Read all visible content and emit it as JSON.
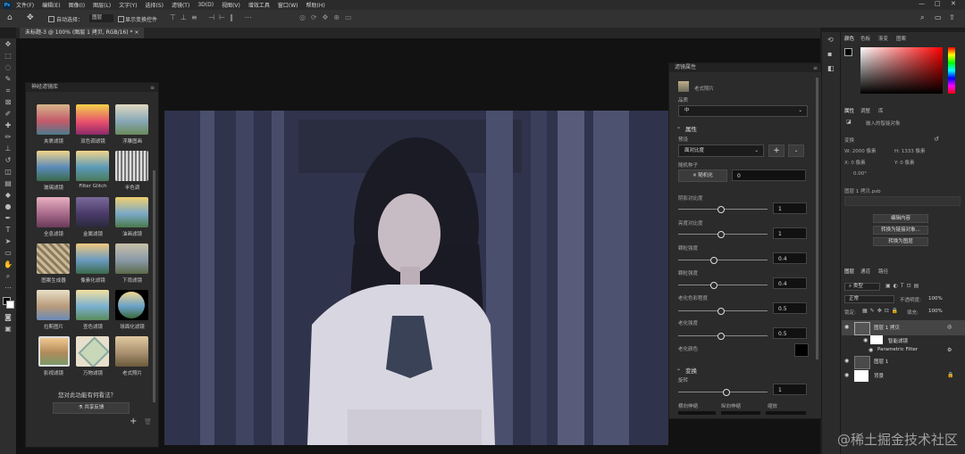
{
  "menu": [
    "文件(F)",
    "编辑(E)",
    "图像(I)",
    "图层(L)",
    "文字(Y)",
    "选择(S)",
    "滤镜(T)",
    "3D(D)",
    "视图(V)",
    "增效工具",
    "窗口(W)",
    "帮助(H)"
  ],
  "options": {
    "auto_select": "自动选择：",
    "layer_select": "图层",
    "show_transform": "显示变换控件"
  },
  "doc_tab": "未标题-3 @ 100% (图层 1 拷贝, RGB/16) *",
  "neural_panel": {
    "title": "神经滤镜库",
    "filters": [
      "夹裹滤镜",
      "双色调滤镜",
      "浮雕图画",
      "玻璃滤镜",
      "Filter Glitch",
      "半色调",
      "全息滤镜",
      "金属滤镜",
      "油画滤镜",
      "图案生成器",
      "像素化滤镜",
      "下雨滤镜",
      "拉斯图片",
      "查色滤镜",
      "球面化滤镜",
      "影视滤镜",
      "万物滤镜",
      "老式照片"
    ],
    "feedback_q": "您对此功能有何看法？",
    "feedback_btn": "共享反馈",
    "add": "+"
  },
  "filter_props": {
    "title": "滤镜属性",
    "filter_name": "老式照片",
    "quality_label": "品质",
    "quality_value": "中",
    "props_header": "属性",
    "preset_label": "预设",
    "preset_value": "面对比度",
    "random_label": "随机种子",
    "random_btn": "随机化",
    "random_value": "0",
    "sliders": [
      {
        "label": "阴影对比度",
        "value": "1"
      },
      {
        "label": "亮度对比度",
        "value": "1"
      },
      {
        "label": "颗粒强度",
        "value": "0.4"
      },
      {
        "label": "颗粒强度",
        "value": "0.4"
      },
      {
        "label": "老化色彩程度",
        "value": "0.5"
      },
      {
        "label": "老化强度",
        "value": "0.5"
      }
    ],
    "color_label": "老化颜色",
    "transform_header": "变换",
    "rotate_label": "旋转",
    "rotate_value": "1",
    "bottom_labels": [
      "横向伸缩",
      "纵向伸缩",
      "缩放"
    ]
  },
  "right_top_tabs": [
    "颜色",
    "色板",
    "渐变",
    "图案"
  ],
  "props_tabs": [
    "属性",
    "调整",
    "库"
  ],
  "props": {
    "smart_obj": "嵌入的智能对象",
    "transform": "变换",
    "w": "W: 2000 像素",
    "h": "H: 1333 像素",
    "x": "X: 0 像素",
    "y": "Y: 0 像素",
    "angle": "0.00°",
    "layer_file": "图层 1 拷贝.psb",
    "btn_edit": "编辑内容",
    "btn_convert_linked": "转换为链接对象...",
    "btn_convert_layers": "转换为图层"
  },
  "layers_tabs": [
    "图层",
    "通道",
    "路径"
  ],
  "layers": {
    "kind": "类型",
    "blend": "正常",
    "opacity_label": "不透明度:",
    "opacity_value": "100%",
    "fill_label": "填充:",
    "fill_value": "100%",
    "lock": "锁定:",
    "items": [
      "图层 1 拷贝",
      "智能滤镜",
      "Parametric Filter",
      "图层 1",
      "背景"
    ]
  },
  "watermark": "@稀土掘金技术社区",
  "colors": {
    "accent": "#1473e6",
    "panel": "#2b2b2b",
    "dark": "#121212"
  }
}
